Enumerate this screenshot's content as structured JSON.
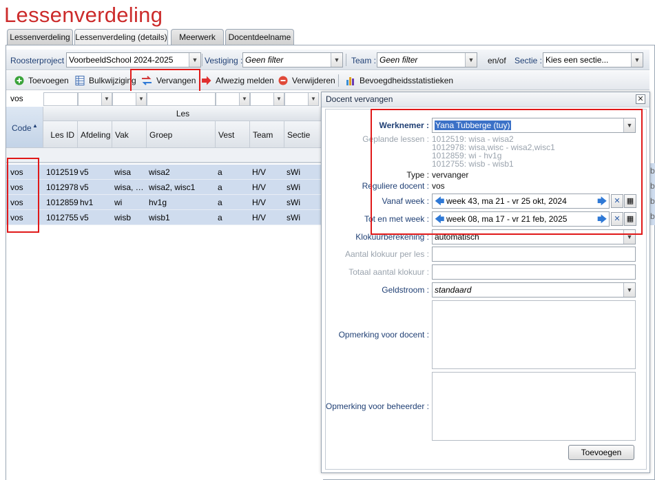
{
  "app_title": "Lessenverdeling",
  "tabs": [
    {
      "label": "Lessenverdeling"
    },
    {
      "label": "Lessenverdeling (details)"
    },
    {
      "label": "Meerwerk"
    },
    {
      "label": "Docentdeelname"
    }
  ],
  "filters": {
    "roosterproject_label": "Roosterproject :",
    "roosterproject_value": "VoorbeeldSchool 2024-2025",
    "vestiging_label": "Vestiging :",
    "vestiging_value": "Geen filter",
    "team_label": "Team :",
    "team_value": "Geen filter",
    "enof_label": "en/of",
    "sectie_label": "Sectie :",
    "sectie_value": "Kies een sectie..."
  },
  "toolbar": {
    "add": "Toevoegen",
    "bulk": "Bulkwijziging",
    "replace": "Vervangen",
    "absent": "Afwezig melden",
    "delete": "Verwijderen",
    "stats": "Bevoegdheidsstatistieken"
  },
  "grid": {
    "filter_code_value": "vos",
    "group_header": "Les",
    "columns": {
      "code": "Code",
      "les_id": "Les ID",
      "afdeling": "Afdeling",
      "vak": "Vak",
      "groep": "Groep",
      "vest": "Vest",
      "team": "Team",
      "sectie": "Sectie"
    },
    "rows": [
      {
        "code": "vos",
        "les_id": "1012519",
        "afdeling": "v5",
        "vak": "wisa",
        "groep": "wisa2",
        "vest": "a",
        "team": "H/V",
        "sectie": "sWi"
      },
      {
        "code": "vos",
        "les_id": "1012978",
        "afdeling": "v5",
        "vak": "wisa, …",
        "groep": "wisa2, wisc1",
        "vest": "a",
        "team": "H/V",
        "sectie": "sWi"
      },
      {
        "code": "vos",
        "les_id": "1012859",
        "afdeling": "hv1",
        "vak": "wi",
        "groep": "hv1g",
        "vest": "a",
        "team": "H/V",
        "sectie": "sWi"
      },
      {
        "code": "vos",
        "les_id": "1012755",
        "afdeling": "v5",
        "vak": "wisb",
        "groep": "wisb1",
        "vest": "a",
        "team": "H/V",
        "sectie": "sWi"
      }
    ],
    "right_edge_glyph": "b"
  },
  "dialog": {
    "title": "Docent vervangen",
    "werknemer_label": "Werknemer :",
    "werknemer_value": "Yana Tubberge (tuy)",
    "geplande_label": "Geplande lessen :",
    "geplande_lines": [
      "1012519: wisa - wisa2",
      "1012978: wisa,wisc - wisa2,wisc1",
      "1012859: wi - hv1g",
      "1012755: wisb - wisb1"
    ],
    "type_label": "Type :",
    "type_value": "vervanger",
    "reguliere_label": "Reguliere docent :",
    "reguliere_value": "vos",
    "vanaf_label": "Vanaf week :",
    "vanaf_value": "week 43, ma 21 - vr 25 okt, 2024",
    "tot_label": "Tot en met week :",
    "tot_value": "week 08, ma 17 - vr 21 feb, 2025",
    "klokuur_label": "Klokuurberekening :",
    "klokuur_value": "automatisch",
    "aantal_label": "Aantal klokuur per les :",
    "totaal_label": "Totaal aantal klokuur :",
    "geldstroom_label": "Geldstroom :",
    "geldstroom_value": "standaard",
    "opm_docent_label": "Opmerking voor docent :",
    "opm_beheerder_label": "Opmerking voor beheerder :",
    "submit": "Toevoegen"
  },
  "colors": {
    "title_red": "#cc2b2b",
    "label_blue": "#1f3f74",
    "row_selected": "#cfdcee",
    "highlight_red": "#e01818",
    "arrow_blue": "#2f79d6"
  }
}
